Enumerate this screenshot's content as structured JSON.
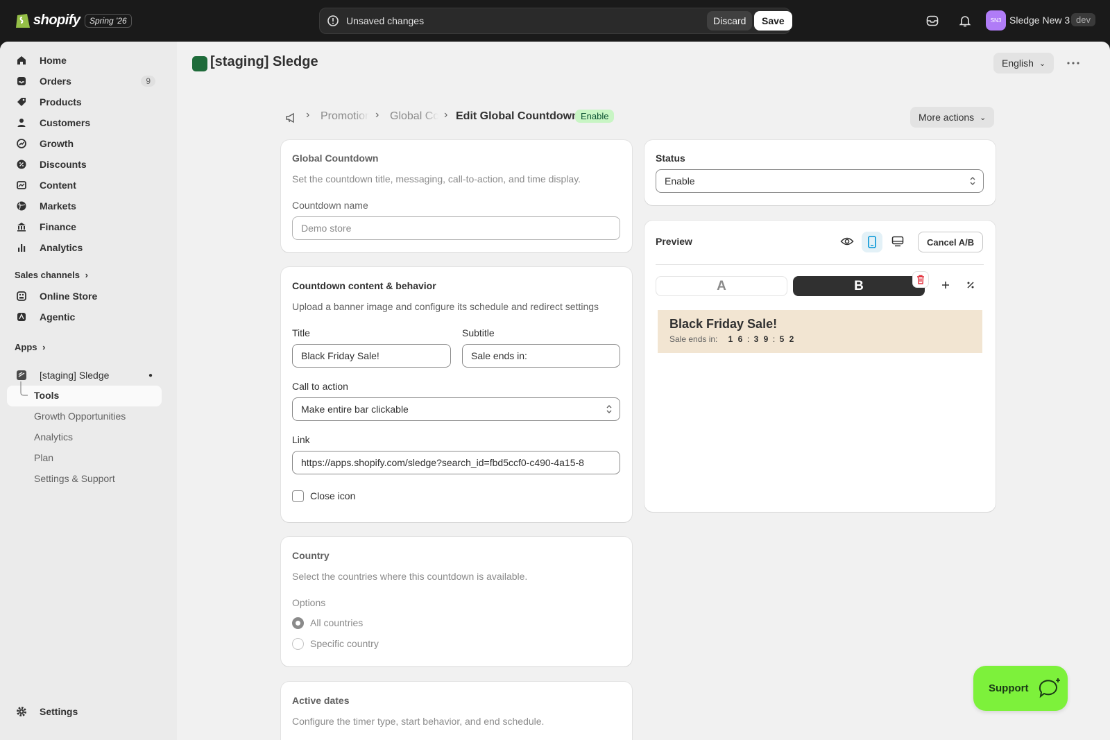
{
  "topbar": {
    "logo_text": "shopify",
    "edition": "Spring '26",
    "unsaved_text": "Unsaved changes",
    "discard_label": "Discard",
    "save_label": "Save",
    "avatar_initials": "SN3",
    "store_name": "Sledge New 3",
    "env_badge": "dev"
  },
  "sidebar": {
    "items": [
      {
        "label": "Home",
        "icon": "home-icon"
      },
      {
        "label": "Orders",
        "icon": "orders-icon",
        "count": "9"
      },
      {
        "label": "Products",
        "icon": "tag-icon"
      },
      {
        "label": "Customers",
        "icon": "person-icon"
      },
      {
        "label": "Growth",
        "icon": "growth-icon"
      },
      {
        "label": "Discounts",
        "icon": "discount-icon"
      },
      {
        "label": "Content",
        "icon": "content-icon"
      },
      {
        "label": "Markets",
        "icon": "globe-icon"
      },
      {
        "label": "Finance",
        "icon": "bank-icon"
      },
      {
        "label": "Analytics",
        "icon": "chart-icon"
      }
    ],
    "sales_channels_label": "Sales channels",
    "channels": [
      {
        "label": "Online Store"
      },
      {
        "label": "Agentic"
      }
    ],
    "apps_label": "Apps",
    "app_name": "[staging] Sledge",
    "app_subitems": [
      "Tools",
      "Growth Opportunities",
      "Analytics",
      "Plan",
      "Settings & Support"
    ],
    "settings_label": "Settings"
  },
  "header": {
    "title": "[staging] Sledge",
    "language": "English"
  },
  "breadcrumb": {
    "items": [
      "Promotion",
      "Global Countdown"
    ],
    "current": "Edit Global Countdown",
    "status_badge": "Enable",
    "more_actions": "More actions"
  },
  "global_countdown": {
    "title": "Global Countdown",
    "description": "Set the countdown title, messaging, call-to-action, and time display.",
    "name_label": "Countdown name",
    "name_placeholder": "Demo store"
  },
  "content_behavior": {
    "title": "Countdown content & behavior",
    "description": "Upload a banner image and configure its schedule and redirect settings",
    "title_label": "Title",
    "title_value": "Black Friday Sale!",
    "subtitle_label": "Subtitle",
    "subtitle_value": "Sale ends in:",
    "cta_label": "Call to action",
    "cta_value": "Make entire bar clickable",
    "link_label": "Link",
    "link_value": "https://apps.shopify.com/sledge?search_id=fbd5ccf0-c490-4a15-8",
    "close_icon_label": "Close icon"
  },
  "country": {
    "title": "Country",
    "description": "Select the countries where this countdown is available.",
    "options_label": "Options",
    "options": [
      "All countries",
      "Specific country"
    ]
  },
  "active_dates": {
    "title": "Active dates",
    "description": "Configure the timer type, start behavior, and end schedule."
  },
  "status": {
    "title": "Status",
    "value": "Enable"
  },
  "preview": {
    "title": "Preview",
    "cancel_ab": "Cancel A/B",
    "tab_a": "A",
    "tab_b": "B",
    "bar_title": "Black Friday Sale!",
    "bar_subtitle": "Sale ends in:",
    "timer": [
      "1",
      "6",
      ":",
      "3",
      "9",
      ":",
      "5",
      "2"
    ],
    "bar_color": "#f2e5d2"
  },
  "support_label": "Support",
  "colors": {
    "accent_green": "#7df13b",
    "badge_green": "#c8f5c4",
    "topbar": "#1a1a1a"
  }
}
